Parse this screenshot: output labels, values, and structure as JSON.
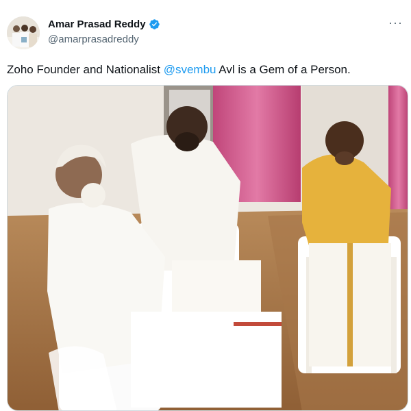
{
  "author": {
    "display_name": "Amar Prasad Reddy",
    "handle": "@amarprasadreddy",
    "verified": true,
    "avatar_icon": "profile-photo"
  },
  "more_menu_icon": "more-horizontal-icon",
  "tweet": {
    "text_before": "Zoho Founder and Nationalist ",
    "mention": "@svembu",
    "text_after": " Avl is a Gem of a Person."
  },
  "media": {
    "type": "photo",
    "description_icon": "tweet-photo"
  },
  "colors": {
    "mention": "#1d9bf0",
    "verified_badge": "#1d9bf0",
    "handle": "#536471",
    "border": "#cfd9de"
  }
}
